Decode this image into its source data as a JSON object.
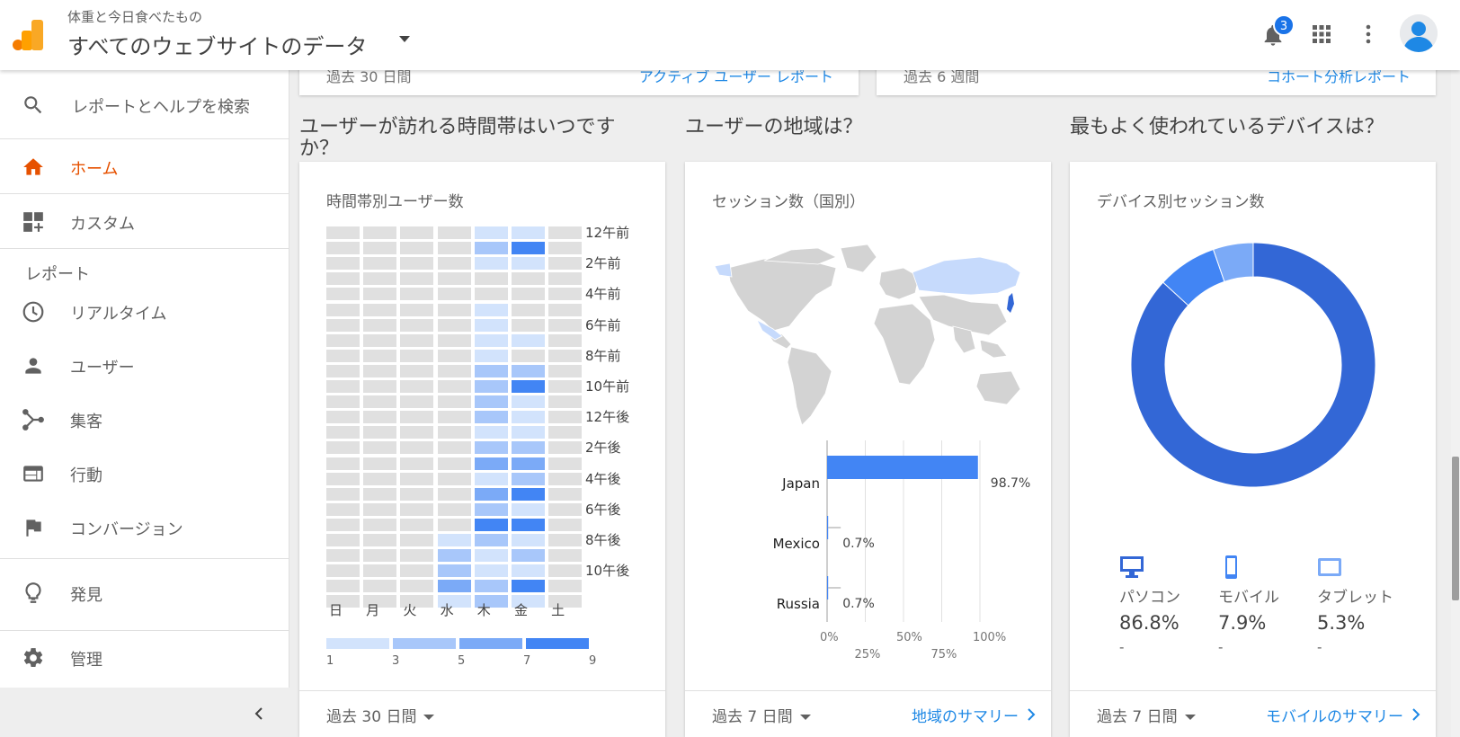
{
  "header": {
    "account_sub": "体重と今日食べたもの",
    "account_title": "すべてのウェブサイトのデータ",
    "notification_count": "3"
  },
  "sidebar": {
    "search_label": "レポートとヘルプを検索",
    "home_label": "ホーム",
    "custom_label": "カスタム",
    "reports_section": "レポート",
    "realtime_label": "リアルタイム",
    "users_label": "ユーザー",
    "acquisition_label": "集客",
    "behavior_label": "行動",
    "conversion_label": "コンバージョン",
    "discover_label": "発見",
    "admin_label": "管理"
  },
  "top_cards": {
    "left_period": "過去 30 日間",
    "left_link": "アクティブ ユーザー レポート",
    "right_period": "過去 6 週間",
    "right_link": "コホート分析レポート"
  },
  "sections": {
    "time_title": "ユーザーが訪れる時間帯はいつですか？",
    "geo_title": "ユーザーの地域は？",
    "device_title": "最もよく使われているデバイスは？"
  },
  "heatmap_card": {
    "title": "時間帯別ユーザー数",
    "period": "過去 30 日間",
    "days": [
      "日",
      "月",
      "火",
      "水",
      "木",
      "金",
      "土"
    ],
    "hour_labels": [
      "12午前",
      "2午前",
      "4午前",
      "6午前",
      "8午前",
      "10午前",
      "12午後",
      "2午後",
      "4午後",
      "6午後",
      "8午後",
      "10午後"
    ],
    "legend_values": [
      "1",
      "3",
      "5",
      "7",
      "9"
    ],
    "legend_colors": [
      "#d2e3fc",
      "#a8c7fa",
      "#7baaf7",
      "#4285f4"
    ],
    "empty_color": "#e0e0e0",
    "levels": [
      [
        0,
        0,
        0,
        0,
        1,
        1,
        0
      ],
      [
        0,
        0,
        0,
        0,
        2,
        4,
        0
      ],
      [
        0,
        0,
        0,
        0,
        1,
        1,
        0
      ],
      [
        0,
        0,
        0,
        0,
        0,
        0,
        0
      ],
      [
        0,
        0,
        0,
        0,
        0,
        0,
        0
      ],
      [
        0,
        0,
        0,
        0,
        1,
        0,
        0
      ],
      [
        0,
        0,
        0,
        0,
        1,
        0,
        0
      ],
      [
        0,
        0,
        0,
        0,
        1,
        1,
        0
      ],
      [
        0,
        0,
        0,
        0,
        1,
        0,
        0
      ],
      [
        0,
        0,
        0,
        0,
        2,
        2,
        0
      ],
      [
        0,
        0,
        0,
        0,
        2,
        4,
        0
      ],
      [
        0,
        0,
        0,
        0,
        2,
        1,
        0
      ],
      [
        0,
        0,
        0,
        0,
        2,
        1,
        0
      ],
      [
        0,
        0,
        0,
        0,
        1,
        1,
        0
      ],
      [
        0,
        0,
        0,
        0,
        2,
        2,
        0
      ],
      [
        0,
        0,
        0,
        0,
        3,
        3,
        0
      ],
      [
        0,
        0,
        0,
        0,
        1,
        2,
        0
      ],
      [
        0,
        0,
        0,
        0,
        3,
        4,
        0
      ],
      [
        0,
        0,
        0,
        0,
        2,
        1,
        0
      ],
      [
        0,
        0,
        0,
        0,
        4,
        4,
        0
      ],
      [
        0,
        0,
        0,
        1,
        2,
        1,
        0
      ],
      [
        0,
        0,
        0,
        2,
        1,
        2,
        0
      ],
      [
        0,
        0,
        0,
        2,
        1,
        1,
        0
      ],
      [
        0,
        0,
        0,
        3,
        2,
        4,
        0
      ],
      [
        0,
        0,
        0,
        1,
        2,
        1,
        0
      ]
    ]
  },
  "geo_card": {
    "title": "セッション数（国別）",
    "period": "過去 7 日間",
    "link": "地域のサマリー",
    "countries": [
      "Japan",
      "Mexico",
      "Russia"
    ],
    "value_labels": [
      "98.7%",
      "0.7%",
      "0.7%"
    ],
    "axis_top": [
      "0%",
      "50%",
      "100%"
    ],
    "axis_bottom": [
      "25%",
      "75%"
    ],
    "bar_color": "#4285f4"
  },
  "chart_data": {
    "type": "bar",
    "categories": [
      "Japan",
      "Mexico",
      "Russia"
    ],
    "values": [
      98.7,
      0.7,
      0.7
    ],
    "title": "セッション数（国別）",
    "xlim": [
      0,
      100
    ]
  },
  "device_card": {
    "title": "デバイス別セッション数",
    "period": "過去 7 日間",
    "link": "モバイルのサマリー",
    "devices": [
      {
        "name": "パソコン",
        "value": "86.8%",
        "sub": "-"
      },
      {
        "name": "モバイル",
        "value": "7.9%",
        "sub": "-"
      },
      {
        "name": "タブレット",
        "value": "5.3%",
        "sub": "-"
      }
    ],
    "shares": [
      86.8,
      7.9,
      5.3
    ],
    "colors": [
      "#3367d6",
      "#4285f4",
      "#7baaf7"
    ]
  }
}
